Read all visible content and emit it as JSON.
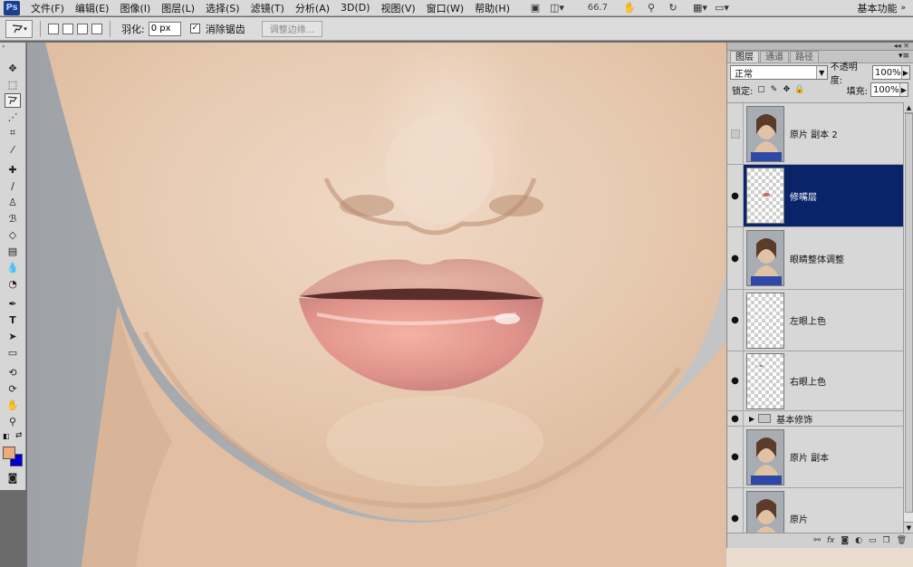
{
  "app": {
    "logo_text": "Ps"
  },
  "menu": [
    "文件(F)",
    "编辑(E)",
    "图像(I)",
    "图层(L)",
    "选择(S)",
    "滤镜(T)",
    "分析(A)",
    "3D(D)",
    "视图(V)",
    "窗口(W)",
    "帮助(H)"
  ],
  "menubar": {
    "zoom": "66.7",
    "workspace": "基本功能"
  },
  "options": {
    "feather_label": "羽化:",
    "feather_value": "0 px",
    "antialias_label": "消除锯齿",
    "antialias_checked": true,
    "refine_edge": "调整边缘..."
  },
  "colors": {
    "foreground": "#f0a97a",
    "background": "#0000cc",
    "selected_layer": "#0a246a"
  },
  "layers_panel": {
    "tabs": [
      "图层",
      "通道",
      "路径"
    ],
    "active_tab": "图层",
    "blend_mode": "正常",
    "opacity_label": "不透明度:",
    "opacity_value": "100%",
    "lock_label": "锁定:",
    "fill_label": "填充:",
    "fill_value": "100%",
    "group_name": "基本修饰",
    "layers": [
      {
        "name": "原片 副本 2",
        "visible": false,
        "selected": false,
        "thumb": "portrait"
      },
      {
        "name": "修嘴层",
        "visible": true,
        "selected": true,
        "thumb": "transparent-dot"
      },
      {
        "name": "眼睛整体调整",
        "visible": true,
        "selected": false,
        "thumb": "portrait"
      },
      {
        "name": "左眼上色",
        "visible": true,
        "selected": false,
        "thumb": "transparent"
      },
      {
        "name": "右眼上色",
        "visible": true,
        "selected": false,
        "thumb": "transparent-dot"
      },
      {
        "name": "原片 副本",
        "visible": true,
        "selected": false,
        "thumb": "portrait"
      },
      {
        "name": "原片",
        "visible": true,
        "selected": false,
        "thumb": "portrait"
      }
    ]
  }
}
